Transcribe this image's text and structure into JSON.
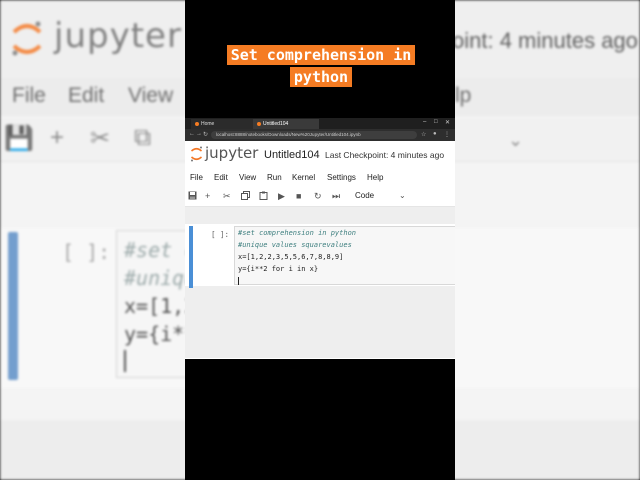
{
  "overlay": {
    "title_line1": "Set comprehension in",
    "title_line2": "python"
  },
  "colors": {
    "accent": "#f57c23",
    "cell_active": "#4a8fd6"
  },
  "browser": {
    "tabs": [
      {
        "label": "Home"
      },
      {
        "label": "Untitled104"
      }
    ],
    "url": "localhost:8888/notebooks/Downloads/New%20Jupyter/Untitled104.ipynb"
  },
  "notebook": {
    "logo_text": "jupyter",
    "title": "Untitled104",
    "checkpoint": "Last Checkpoint: 4 minutes ago",
    "menu": [
      "File",
      "Edit",
      "View",
      "Run",
      "Kernel",
      "Settings",
      "Help"
    ],
    "toolbar_icons": [
      "save-icon",
      "add-icon",
      "cut-icon",
      "copy-icon",
      "paste-icon",
      "run-icon",
      "stop-icon",
      "restart-icon",
      "fast-forward-icon"
    ],
    "cell_type": "Code",
    "cell": {
      "prompt": "[ ]:",
      "code": [
        "#set comprehension in python",
        "#unique values squarevalues",
        "x=[1,2,2,3,5,5,6,7,8,8,9]",
        "y={i**2 for i in x}"
      ]
    }
  },
  "background": {
    "logo_text": "jupyter",
    "checkpoint_fragment": "oint: 4 minutes ago",
    "menu": [
      "File",
      "Edit",
      "View"
    ],
    "menu_fragment": "lp",
    "cell_prompt": "[ ]:",
    "code": [
      "#set c",
      "#uniqu",
      "x=[1,2",
      "y={i**"
    ]
  }
}
